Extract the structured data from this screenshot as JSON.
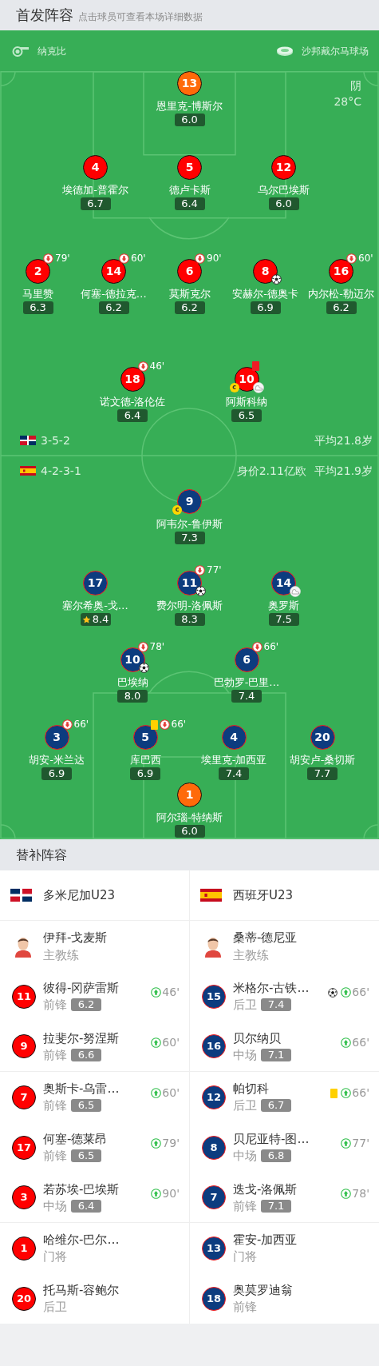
{
  "header": {
    "title": "首发阵容",
    "subtitle": "点击球员可查看本场详细数据"
  },
  "match_info": {
    "referee": "纳克比",
    "stadium": "沙邦戴尔马球场",
    "weather": "阴",
    "temperature": "28°C"
  },
  "home": {
    "formation": "3-5-2",
    "stats": [
      "平均21.8岁"
    ],
    "lines": [
      [
        {
          "number": "13",
          "name": "恩里克-博斯尔",
          "rating": "6.0",
          "keeper": true
        }
      ],
      [
        {
          "number": "4",
          "name": "埃德加-普霍尔",
          "rating": "6.7",
          "keeper": false
        },
        {
          "number": "5",
          "name": "德卢卡斯",
          "rating": "6.4",
          "keeper": false
        },
        {
          "number": "12",
          "name": "乌尔巴埃斯",
          "rating": "6.0",
          "keeper": false
        }
      ],
      [
        {
          "number": "2",
          "name": "马里赞",
          "rating": "6.3",
          "keeper": false,
          "events": [
            {
              "kind": "sub_off",
              "minute": "79'"
            }
          ]
        },
        {
          "number": "14",
          "name": "何塞-德拉克…",
          "rating": "6.2",
          "keeper": false,
          "events": [
            {
              "kind": "sub_off",
              "minute": "60'"
            }
          ]
        },
        {
          "number": "6",
          "name": "莫斯克尔",
          "rating": "6.2",
          "keeper": false,
          "events": [
            {
              "kind": "sub_off",
              "minute": "90'"
            }
          ]
        },
        {
          "number": "8",
          "name": "安赫尔-德奥卡",
          "rating": "6.9",
          "keeper": false,
          "events": [
            {
              "kind": "goal"
            }
          ]
        },
        {
          "number": "16",
          "name": "内尔松-勒迈尔",
          "rating": "6.2",
          "keeper": false,
          "events": [
            {
              "kind": "sub_off",
              "minute": "60'"
            }
          ]
        }
      ],
      [
        {
          "number": "18",
          "name": "诺文德-洛伦佐",
          "rating": "6.4",
          "keeper": false,
          "events": [
            {
              "kind": "sub_off",
              "minute": "46'"
            }
          ]
        },
        {
          "number": "10",
          "name": "阿斯科纳",
          "rating": "6.5",
          "keeper": false,
          "events": [
            {
              "kind": "red_card"
            },
            {
              "kind": "captain",
              "label": "c"
            },
            {
              "kind": "assist"
            }
          ]
        }
      ]
    ]
  },
  "away": {
    "formation": "4-2-3-1",
    "stats": [
      "身价2.11亿欧",
      "平均21.9岁"
    ],
    "lines": [
      [
        {
          "number": "9",
          "name": "阿韦尔-鲁伊斯",
          "rating": "7.3",
          "keeper": false,
          "events": [
            {
              "kind": "captain",
              "label": "c"
            }
          ]
        }
      ],
      [
        {
          "number": "17",
          "name": "塞尔希奥-戈…",
          "rating": "8.4",
          "keeper": false,
          "events": [
            {
              "kind": "mvp"
            }
          ]
        },
        {
          "number": "11",
          "name": "费尔明-洛佩斯",
          "rating": "8.3",
          "keeper": false,
          "events": [
            {
              "kind": "sub_off",
              "minute": "77'"
            },
            {
              "kind": "goal"
            }
          ]
        },
        {
          "number": "14",
          "name": "奥罗斯",
          "rating": "7.5",
          "keeper": false,
          "events": [
            {
              "kind": "assist"
            }
          ]
        }
      ],
      [
        {
          "number": "10",
          "name": "巴埃纳",
          "rating": "8.0",
          "keeper": false,
          "events": [
            {
              "kind": "sub_off",
              "minute": "78'"
            },
            {
              "kind": "goal"
            }
          ]
        },
        {
          "number": "6",
          "name": "巴勃罗-巴里…",
          "rating": "7.4",
          "keeper": false,
          "events": [
            {
              "kind": "sub_off",
              "minute": "66'"
            }
          ]
        }
      ],
      [
        {
          "number": "3",
          "name": "胡安-米兰达",
          "rating": "6.9",
          "keeper": false,
          "events": [
            {
              "kind": "sub_off",
              "minute": "66'"
            }
          ]
        },
        {
          "number": "5",
          "name": "库巴西",
          "rating": "6.9",
          "keeper": false,
          "events": [
            {
              "kind": "yellow_card"
            },
            {
              "kind": "sub_off",
              "minute": "66'"
            }
          ]
        },
        {
          "number": "4",
          "name": "埃里克-加西亚",
          "rating": "7.4",
          "keeper": false
        },
        {
          "number": "20",
          "name": "胡安卢-桑切斯",
          "rating": "7.7",
          "keeper": false
        }
      ],
      [
        {
          "number": "1",
          "name": "阿尔瑙-特纳斯",
          "rating": "6.0",
          "keeper": true
        }
      ]
    ]
  },
  "bench": {
    "title": "替补阵容",
    "teams": [
      {
        "name": "多米尼加U23",
        "coach": {
          "name": "伊拜-戈麦斯",
          "role": "主教练"
        },
        "subs": [
          {
            "number": "11",
            "name": "彼得-冈萨雷斯",
            "position": "前锋",
            "rating": "6.2",
            "events": [
              {
                "kind": "sub_on",
                "minute": "46'"
              }
            ]
          },
          {
            "number": "9",
            "name": "拉斐尔-努涅斯",
            "position": "前锋",
            "rating": "6.6",
            "events": [
              {
                "kind": "sub_on",
                "minute": "60'"
              }
            ]
          },
          {
            "number": "7",
            "name": "奥斯卡-乌雷…",
            "position": "前锋",
            "rating": "6.5",
            "events": [
              {
                "kind": "sub_on",
                "minute": "60'"
              }
            ]
          },
          {
            "number": "17",
            "name": "何塞-德莱昂",
            "position": "前锋",
            "rating": "6.5",
            "events": [
              {
                "kind": "sub_on",
                "minute": "79'"
              }
            ]
          },
          {
            "number": "3",
            "name": "若苏埃-巴埃斯",
            "position": "中场",
            "rating": "6.4",
            "events": [
              {
                "kind": "sub_on",
                "minute": "90'"
              }
            ]
          },
          {
            "number": "1",
            "name": "哈维尔-巴尔…",
            "position": "门将"
          },
          {
            "number": "20",
            "name": "托马斯-容鲍尔",
            "position": "后卫"
          }
        ]
      },
      {
        "name": "西班牙U23",
        "coach": {
          "name": "桑蒂-德尼亚",
          "role": "主教练"
        },
        "subs": [
          {
            "number": "15",
            "name": "米格尔-古铁…",
            "position": "后卫",
            "rating": "7.4",
            "events": [
              {
                "kind": "goal"
              },
              {
                "kind": "sub_on",
                "minute": "66'"
              }
            ]
          },
          {
            "number": "16",
            "name": "贝尔纳贝",
            "position": "中场",
            "rating": "7.1",
            "events": [
              {
                "kind": "sub_on",
                "minute": "66'"
              }
            ]
          },
          {
            "number": "12",
            "name": "帕切科",
            "position": "后卫",
            "rating": "6.7",
            "events": [
              {
                "kind": "yellow_card"
              },
              {
                "kind": "sub_on",
                "minute": "66'"
              }
            ]
          },
          {
            "number": "8",
            "name": "贝尼亚特-图…",
            "position": "中场",
            "rating": "6.8",
            "events": [
              {
                "kind": "sub_on",
                "minute": "77'"
              }
            ]
          },
          {
            "number": "7",
            "name": "迭戈-洛佩斯",
            "position": "前锋",
            "rating": "7.1",
            "events": [
              {
                "kind": "sub_on",
                "minute": "78'"
              }
            ]
          },
          {
            "number": "13",
            "name": "霍安-加西亚",
            "position": "门将"
          },
          {
            "number": "18",
            "name": "奥莫罗迪翁",
            "position": "前锋"
          }
        ]
      }
    ]
  }
}
